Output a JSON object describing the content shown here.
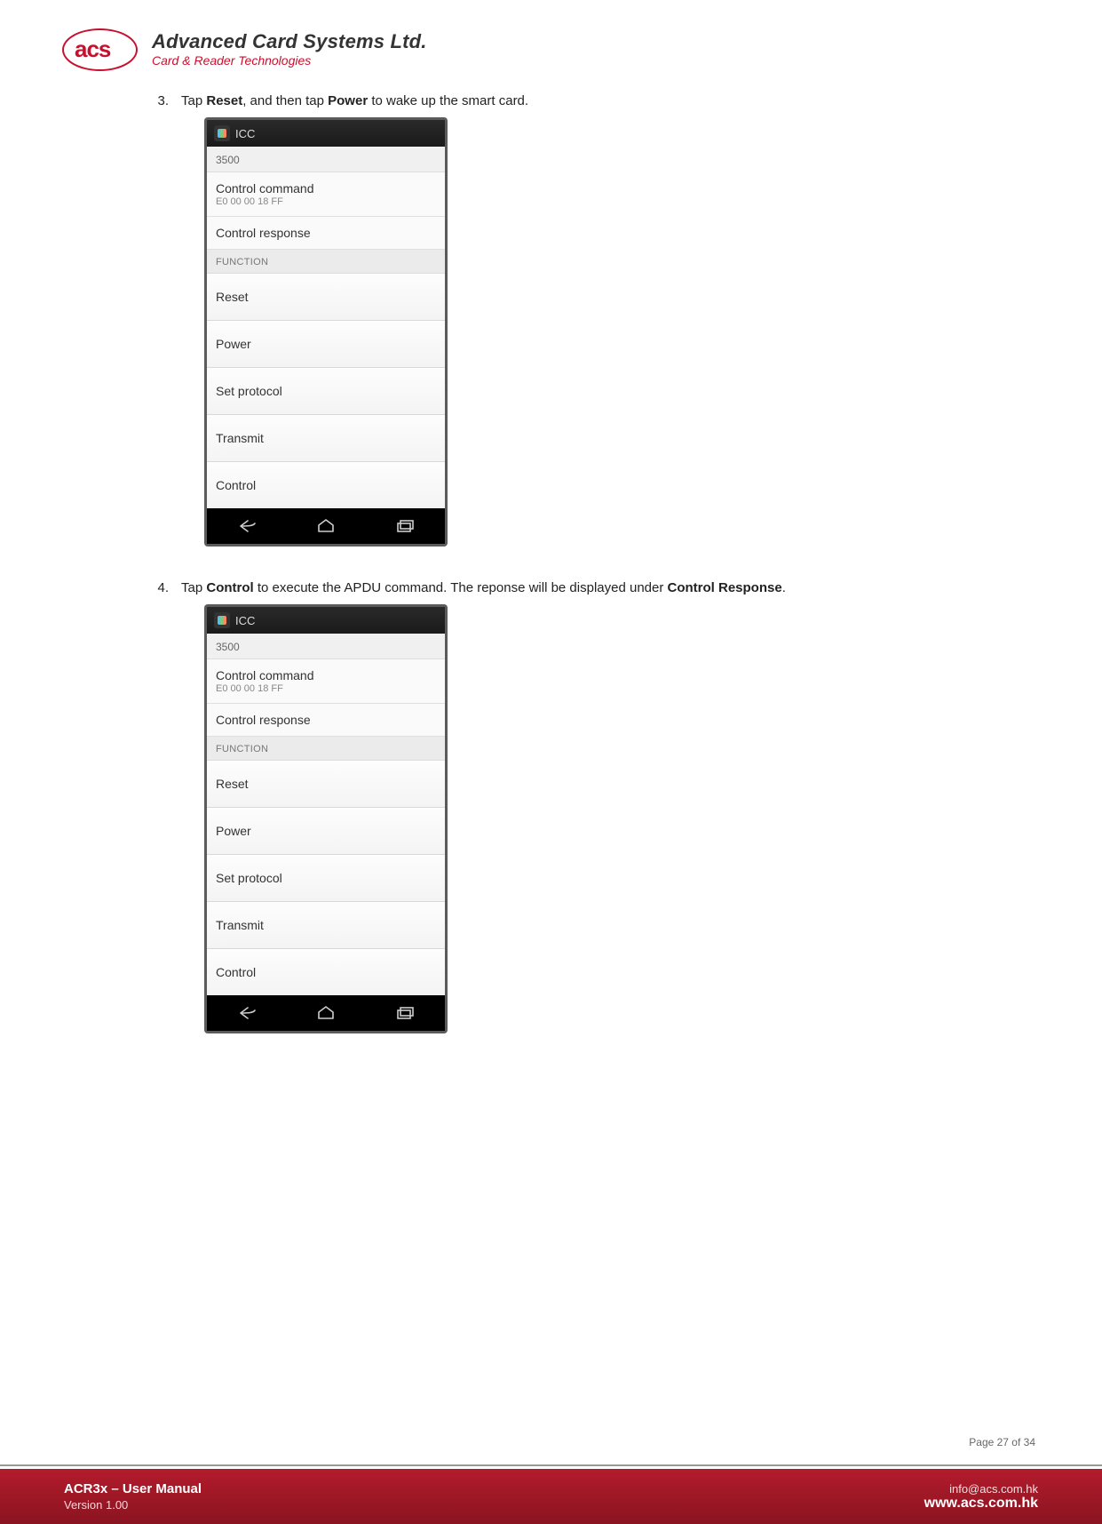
{
  "header": {
    "logo_text": "acs",
    "company_name": "Advanced Card Systems Ltd.",
    "company_tag": "Card & Reader Technologies"
  },
  "steps": {
    "s3": {
      "num": "3.",
      "prefix": "Tap ",
      "b1": "Reset",
      "mid": ", and then tap ",
      "b2": "Power",
      "suffix": " to wake up the smart card."
    },
    "s4": {
      "num": "4.",
      "prefix": "Tap ",
      "b1": "Control",
      "mid": " to execute the APDU command. The reponse will be displayed under ",
      "b2": "Control Response",
      "suffix": "."
    }
  },
  "phone": {
    "app_title": "ICC",
    "status_value": "3500",
    "control_command_label": "Control command",
    "control_command_value": "E0 00 00 18 FF",
    "control_response_label": "Control response",
    "function_header": "FUNCTION",
    "fn_reset": "Reset",
    "fn_power": "Power",
    "fn_set_protocol": "Set protocol",
    "fn_transmit": "Transmit",
    "fn_control": "Control"
  },
  "page_info": "Page 27 of 34",
  "footer": {
    "title": "ACR3x – User Manual",
    "version": "Version 1.00",
    "email": "info@acs.com.hk",
    "url": "www.acs.com.hk"
  }
}
